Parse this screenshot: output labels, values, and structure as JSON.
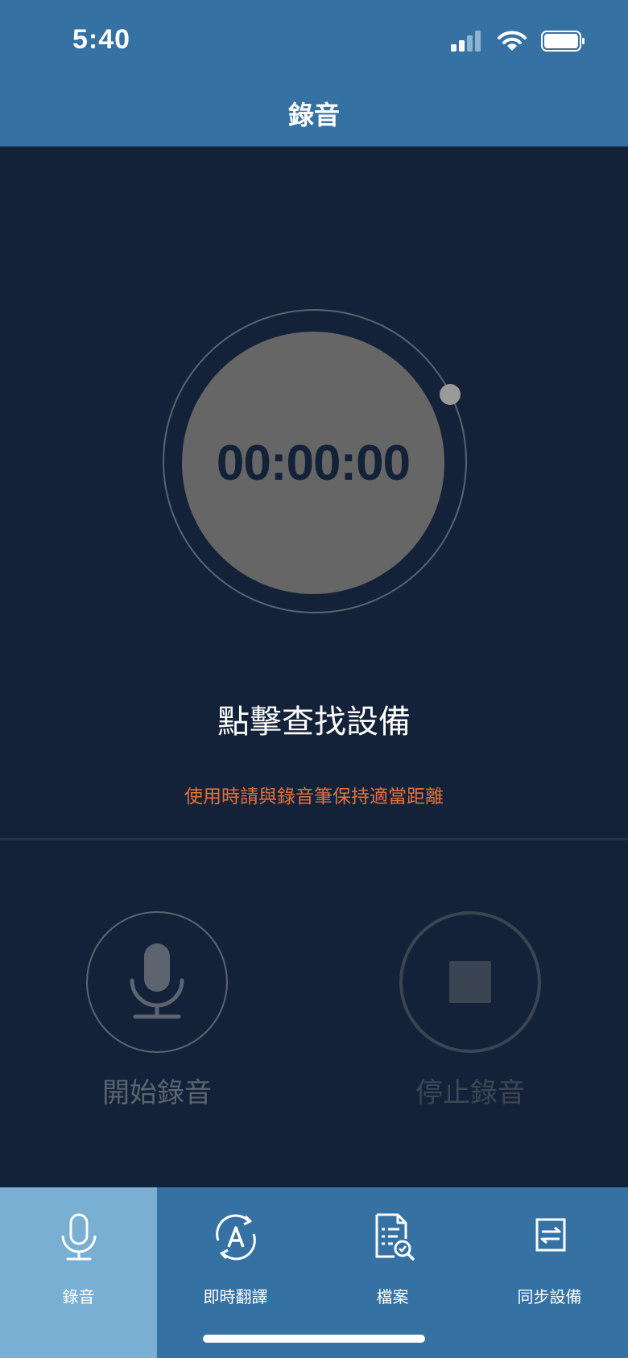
{
  "status_bar": {
    "time": "5:40",
    "icons": [
      "signal-icon",
      "wifi-icon",
      "battery-icon"
    ]
  },
  "header": {
    "title": "錄音"
  },
  "timer": {
    "value": "00:00:00"
  },
  "main": {
    "find_device": "點擊查找設備",
    "hint": "使用時請與錄音筆保持適當距離"
  },
  "controls": {
    "start_label": "開始錄音",
    "stop_label": "停止錄音"
  },
  "tabs": [
    {
      "label": "錄音",
      "icon": "microphone-icon",
      "active": true
    },
    {
      "label": "即時翻譯",
      "icon": "translate-icon",
      "active": false
    },
    {
      "label": "檔案",
      "icon": "file-search-icon",
      "active": false
    },
    {
      "label": "同步設備",
      "icon": "sync-icon",
      "active": false
    }
  ],
  "colors": {
    "header": "#3572a3",
    "background": "#132238",
    "active_tab": "#79afd2",
    "hint": "#e2713d",
    "timer_disc": "#666666"
  }
}
